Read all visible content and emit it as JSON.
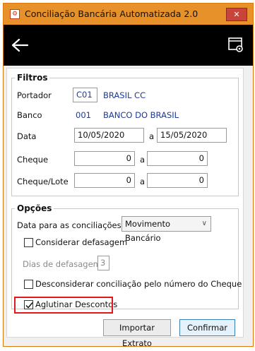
{
  "window": {
    "title": "Conciliação Bancária Automatizada 2.0",
    "close_label": "✕",
    "app_icon": "⚙"
  },
  "filtros": {
    "legend": "Filtros",
    "portador_label": "Portador",
    "portador_code": "C01",
    "portador_name": "BRASIL CC",
    "banco_label": "Banco",
    "banco_code": "001",
    "banco_name": "BANCO DO BRASIL",
    "data_label": "Data",
    "data_from": "10/05/2020",
    "data_sep": "a",
    "data_to": "15/05/2020",
    "cheque_label": "Cheque",
    "cheque_from": "0",
    "cheque_sep": "a",
    "cheque_to": "0",
    "lote_label": "Cheque/Lote",
    "lote_from": "0",
    "lote_sep": "a",
    "lote_to": "0"
  },
  "opcoes": {
    "legend": "Opções",
    "data_conc_label": "Data para as conciliações",
    "data_conc_value": "Movimento Bancário",
    "considerar_label": "Considerar defasagem",
    "considerar_checked": false,
    "dias_label": "Dias de defasagem",
    "dias_value": "3",
    "desconsiderar_label": "Desconsiderar conciliação pelo número do Cheque",
    "desconsiderar_checked": false,
    "aglutinar_label": "Aglutinar Descontos",
    "aglutinar_checked": true
  },
  "buttons": {
    "importar_label": "Importar Extrato",
    "confirmar_label": "Confirmar"
  },
  "icons": {
    "back": "back-arrow-icon",
    "settings": "window-settings-icon"
  },
  "colors": {
    "titlebar": "#e6912a",
    "toolbar": "#000000",
    "link_blue": "#1f3a93",
    "highlight": "#e0181c"
  }
}
